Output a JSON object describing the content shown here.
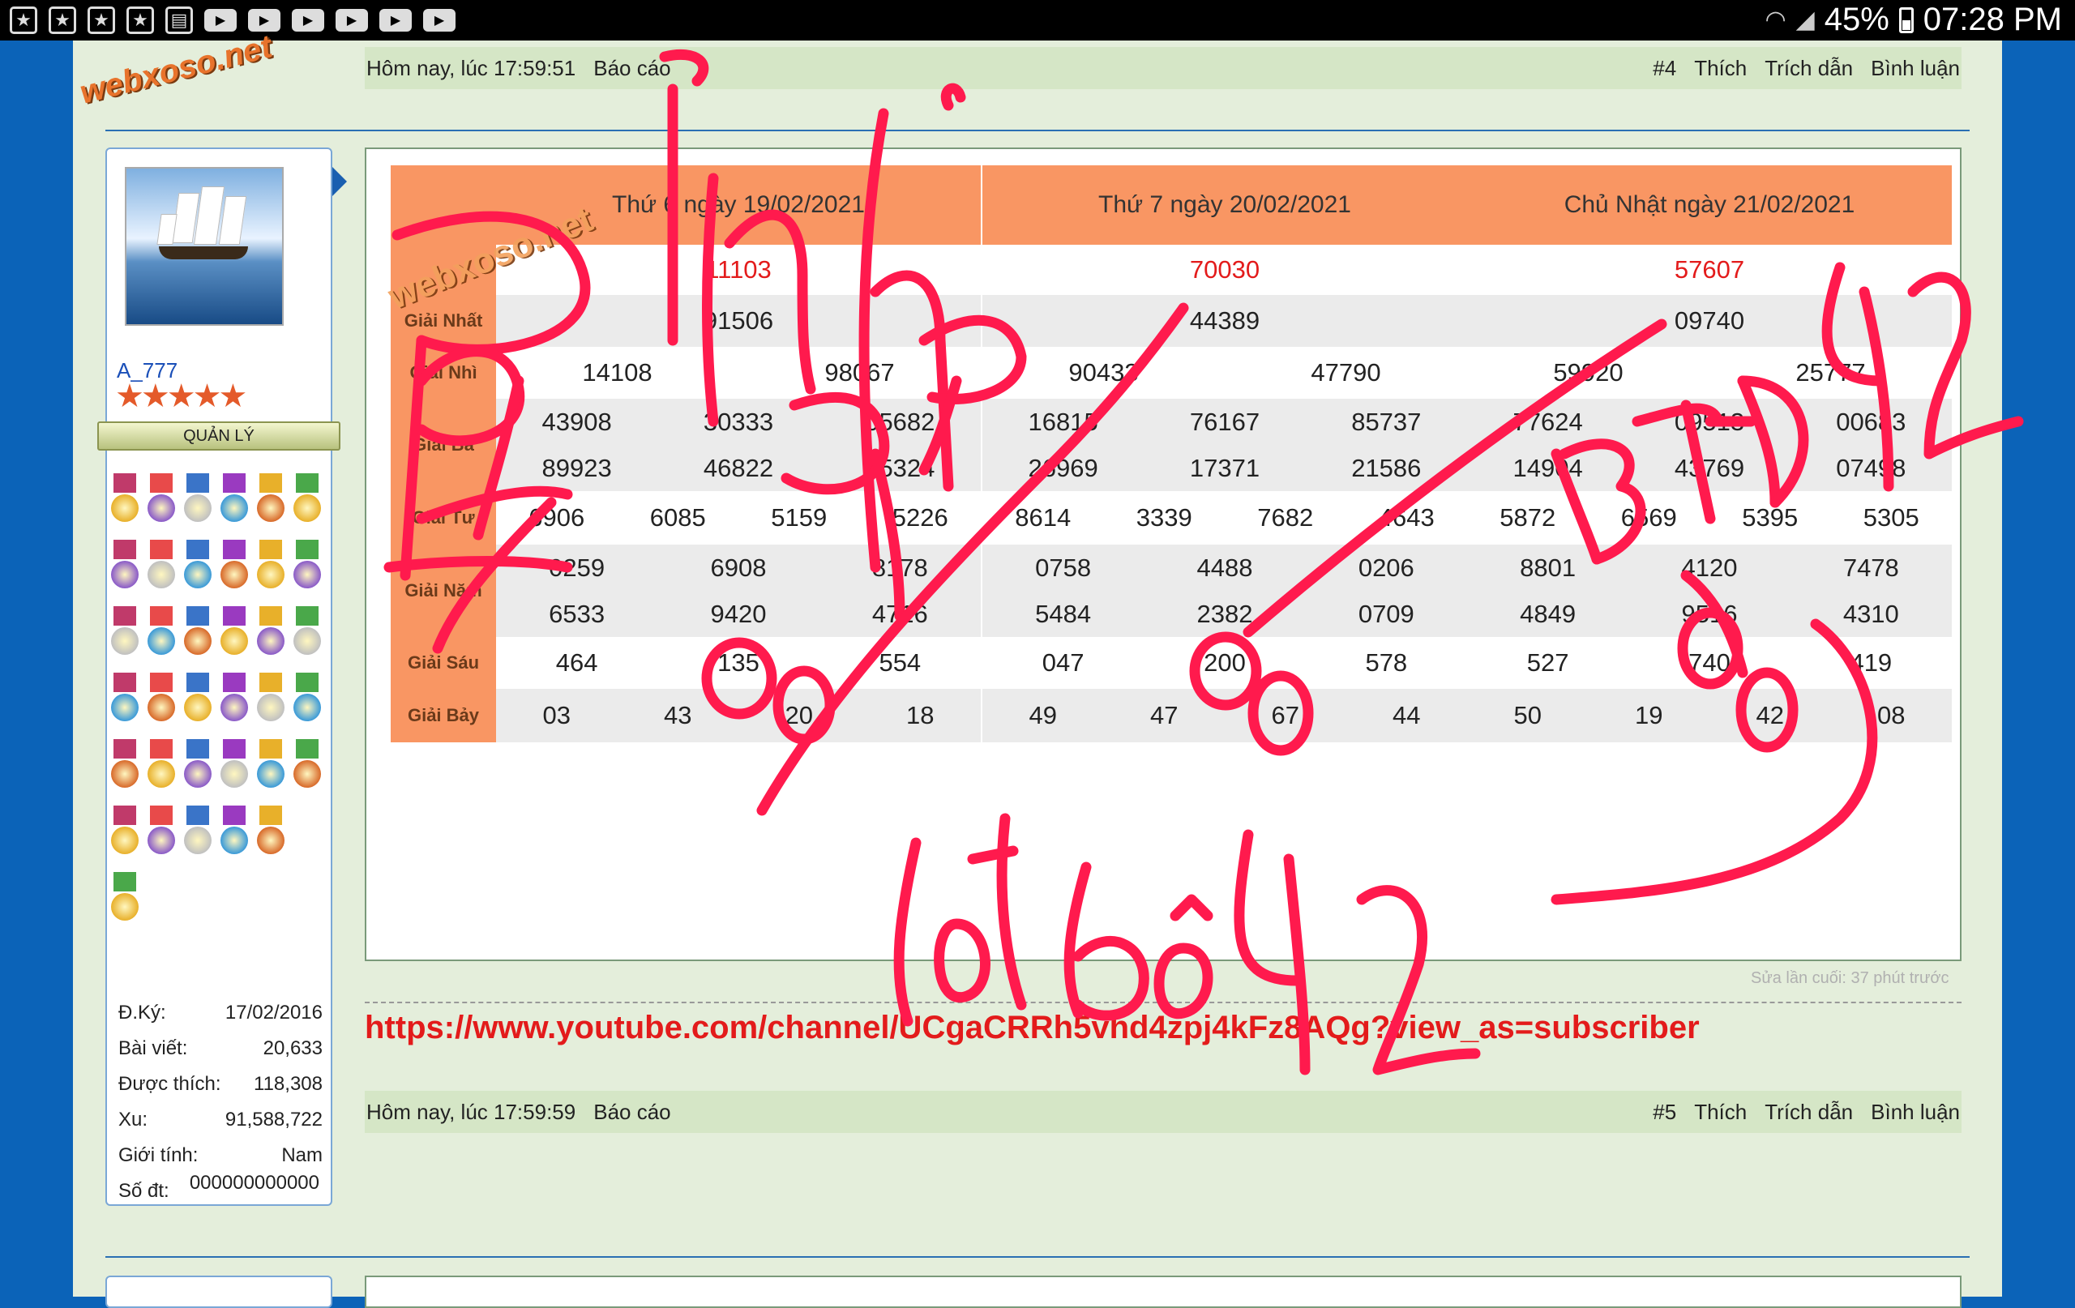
{
  "status_bar": {
    "battery": "45%",
    "time": "07:28 PM"
  },
  "logo": "webxoso.net",
  "post4": {
    "time": "Hôm nay, lúc 17:59:51",
    "report": "Báo cáo",
    "number": "#4",
    "like": "Thích",
    "quote": "Trích dẫn",
    "comment": "Bình luận"
  },
  "user": {
    "name": "A_777",
    "stars": "★★★★★",
    "rank": "QUẢN LÝ",
    "stats": [
      {
        "label": "Đ.Ký:",
        "value": "17/02/2016"
      },
      {
        "label": "Bài viết:",
        "value": "20,633"
      },
      {
        "label": "Được thích:",
        "value": "118,308"
      },
      {
        "label": "Xu:",
        "value": "91,588,722"
      },
      {
        "label": "Giới tính:",
        "value": "Nam"
      },
      {
        "label": "Số đt:",
        "value": ""
      }
    ],
    "phone": "000000000000"
  },
  "results": {
    "watermark": "webxoso.net",
    "row_labels": [
      "Giải Nhất",
      "Giải Nhì",
      "Giải Ba",
      "Giải Tư",
      "Giải Năm",
      "Giải Sáu",
      "Giải Bảy"
    ],
    "columns": [
      {
        "date": "Thứ 6 ngày 19/02/2021",
        "special": "11103",
        "nhat": [
          "91506"
        ],
        "nhi": [
          "14108",
          "98067"
        ],
        "ba": [
          "43908",
          "30333",
          "05682",
          "89923",
          "46822",
          "95324"
        ],
        "tu": [
          "6906",
          "6085",
          "5159",
          "5226"
        ],
        "nam": [
          "0259",
          "6908",
          "8178",
          "6533",
          "9420",
          "4716"
        ],
        "sau": [
          "464",
          "135",
          "554"
        ],
        "bay": [
          "03",
          "43",
          "20",
          "18"
        ]
      },
      {
        "date": "Thứ 7 ngày 20/02/2021",
        "special": "70030",
        "nhat": [
          "44389"
        ],
        "nhi": [
          "90433",
          "47790"
        ],
        "ba": [
          "16815",
          "76167",
          "85737",
          "26969",
          "17371",
          "21586"
        ],
        "tu": [
          "8614",
          "3339",
          "7682",
          "4643"
        ],
        "nam": [
          "0758",
          "4488",
          "0206",
          "5484",
          "2382",
          "0709"
        ],
        "sau": [
          "047",
          "200",
          "578"
        ],
        "bay": [
          "49",
          "47",
          "67",
          "44"
        ]
      },
      {
        "date": "Chủ Nhật ngày 21/02/2021",
        "special": "57607",
        "nhat": [
          "09740"
        ],
        "nhi": [
          "59920",
          "25777"
        ],
        "ba": [
          "77624",
          "09513",
          "00683",
          "14904",
          "43769",
          "07498"
        ],
        "tu": [
          "5872",
          "6569",
          "5395",
          "5305"
        ],
        "nam": [
          "8801",
          "4120",
          "7478",
          "4849",
          "9516",
          "4310"
        ],
        "sau": [
          "527",
          "740",
          "419"
        ],
        "bay": [
          "50",
          "19",
          "42",
          "08"
        ]
      }
    ]
  },
  "edited": "Sửa lần cuối: 37 phút trước",
  "youtube_link": "https://www.youtube.com/channel/UCgaCRRh5vhd4zpj4kFz8AQg?view_as=subscriber",
  "post5": {
    "time": "Hôm nay, lúc 17:59:59",
    "report": "Báo cáo",
    "number": "#5",
    "like": "Thích",
    "quote": "Trích dẫn",
    "comment": "Bình luận"
  },
  "handwriting": [
    "Tam Thủ",
    "97.79.92",
    "BTĐ 42",
    "lót bộ 42"
  ],
  "colors": {
    "header_orange": "#f99663",
    "special_red": "#e31b1b",
    "scribble": "#ff1a4d",
    "page_bg": "#e4eedb",
    "side_blue": "#0b63b8"
  }
}
